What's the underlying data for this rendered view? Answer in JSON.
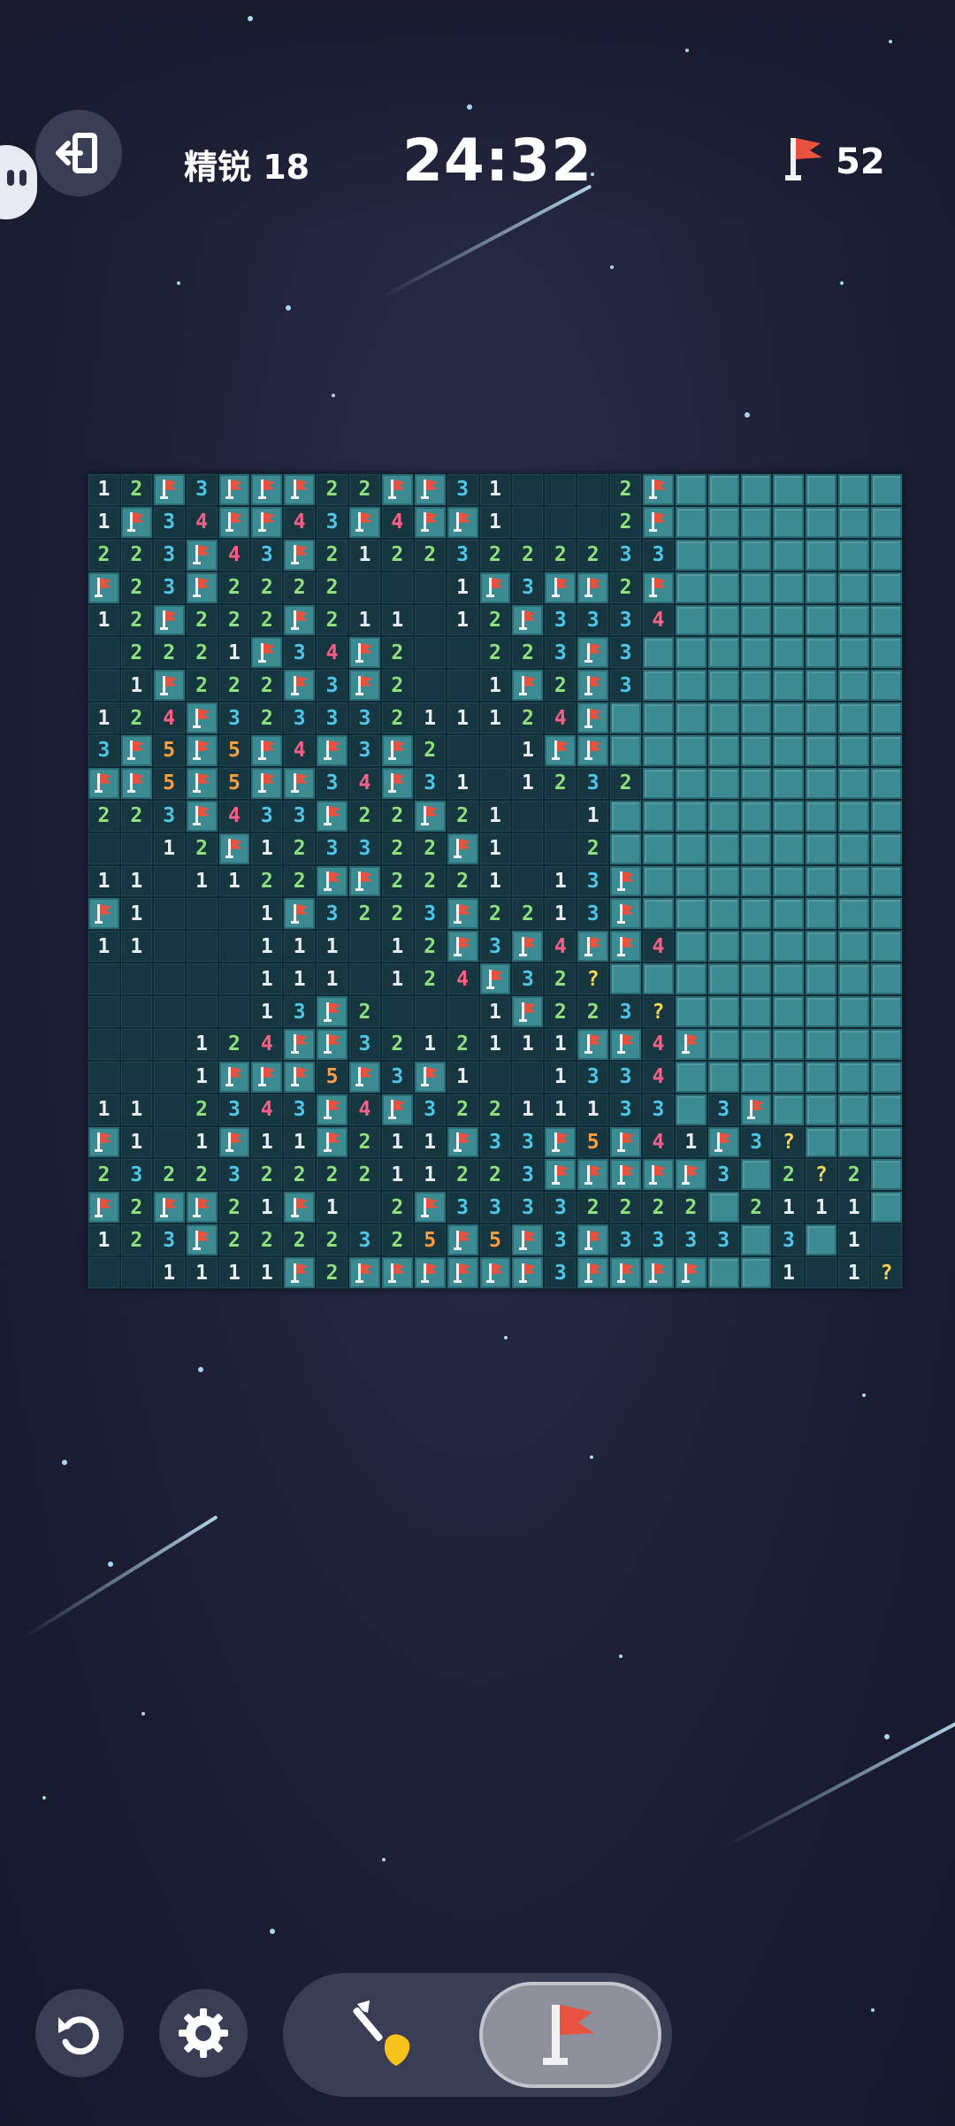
{
  "header": {
    "level_label": "精锐 18",
    "timer": "24:32",
    "flags_remaining": "52"
  },
  "icons": {
    "exit": "exit-icon",
    "flag": "flag-icon",
    "undo": "undo-icon",
    "settings": "gear-icon",
    "dig": "shovel-icon"
  },
  "colors": {
    "closed_tile": "#3d8b92",
    "open_tile": "#163640",
    "flag": "#e8523f",
    "num1": "#e9edf1",
    "num2": "#8ee07c",
    "num3": "#4fc6e8",
    "num4": "#ff5f86",
    "num5": "#ff9d3f",
    "question": "#f5d45a"
  },
  "board": {
    "rows": 25,
    "cols": 25,
    "legend": "digit=revealed number, .=revealed empty, F=flag, ?=question mark, #=unrevealed",
    "grid": [
      "12F3FFF22FF31...2F#######",
      "1F34FF43F4FF1...2F#######",
      "223F43F21223222233#######",
      "F23F2222...1F3FF2F#######",
      "12F222F211.12F3334#######",
      ".2221F34F2..223F3########",
      ".1F222F3F2..1F2F3########",
      "124F32333211124F#########",
      "3F5F5F4F3F2..1FF#########",
      "FF5F5FF34F31.1232########",
      "223F433F22F21..1#########",
      "..12F123322F1..2#########",
      "11.1122FF2221.13F########",
      "F1...1F3223F2213F########",
      "11...111.12F3F4FF4#######",
      ".....111.124F32?#########",
      ".....13F2...1F223?#######",
      "...124FF3212111FF4F######",
      "...1FFF5F3F1..1334#######",
      "11.2343F4F32211133#3F####",
      "F1.1F11F211F33F5F41F3?###",
      "23223222211223FFFFF3#2?2#",
      "F2FF21F1.2F33332222#2111#3",
      "123F2222325F5F3F3333#3#1.1?#",
      "..1111F2FFFFFF3FFFF##1.1?#"
    ]
  }
}
